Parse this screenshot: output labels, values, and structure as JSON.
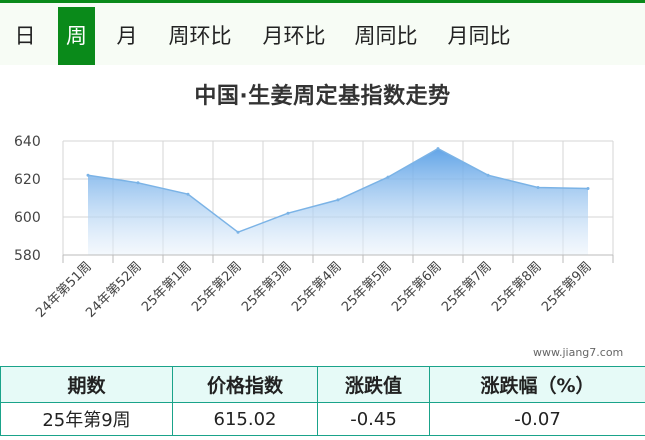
{
  "tabs": [
    {
      "label": "日",
      "active": false
    },
    {
      "label": "周",
      "active": true
    },
    {
      "label": "月",
      "active": false
    },
    {
      "label": "周环比",
      "active": false
    },
    {
      "label": "月环比",
      "active": false
    },
    {
      "label": "周同比",
      "active": false
    },
    {
      "label": "月同比",
      "active": false
    }
  ],
  "watermark": "www.jiang7.com",
  "colors": {
    "accent": "#0a8a1a",
    "line": "#7bb3e6",
    "table_border": "#1aa38a",
    "table_header_bg": "#e6faf7"
  },
  "chart_data": {
    "type": "area",
    "title": "中国·生姜周定基指数走势",
    "categories": [
      "24年第51周",
      "24年第52周",
      "25年第1周",
      "25年第2周",
      "25年第3周",
      "25年第4周",
      "25年第5周",
      "25年第6周",
      "25年第7周",
      "25年第8周",
      "25年第9周"
    ],
    "series": [
      {
        "values": [
          622,
          618,
          612,
          592,
          602,
          609,
          621,
          636,
          622,
          615.5,
          615.02
        ]
      }
    ],
    "yticks": [
      580,
      600,
      620,
      640
    ],
    "ylim": [
      580,
      640
    ],
    "grid": true
  },
  "table": {
    "headers": [
      "期数",
      "价格指数",
      "涨跌值",
      "涨跌幅（%）"
    ],
    "rows": [
      [
        "25年第9周",
        "615.02",
        "-0.45",
        "-0.07"
      ]
    ]
  }
}
